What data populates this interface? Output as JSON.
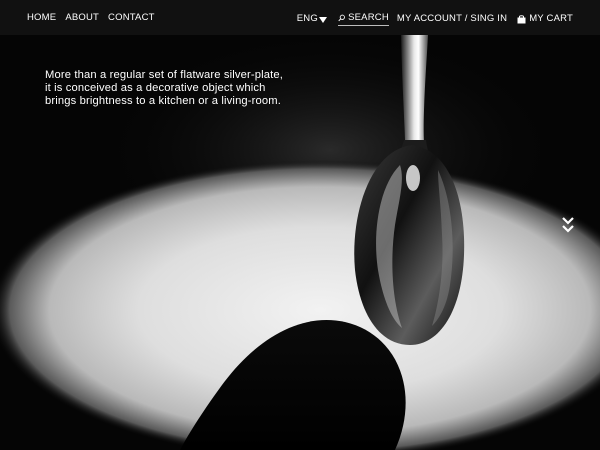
{
  "nav": {
    "left": [
      {
        "label": "HOME"
      },
      {
        "label": "ABOUT"
      },
      {
        "label": "CONTACT"
      }
    ],
    "language": "ENG",
    "search_label": "SEARCH",
    "account_label": "MY ACCOUNT / SING IN",
    "cart_label": "MY CART"
  },
  "hero": {
    "lines": [
      "More than a regular set of flatware silver-plate,",
      "it is conceived as a decorative object which",
      "brings brightness to a kitchen or a living-room."
    ]
  },
  "icons": {
    "search": "magnifier-icon",
    "cart": "shopping-bag-icon",
    "language": "caret-down-icon",
    "scroll": "double-chevron-down-icon"
  },
  "colors": {
    "nav_background": "#121212",
    "text": "#ffffff",
    "spotlight": "#e9e9e9",
    "background": "#050505"
  }
}
